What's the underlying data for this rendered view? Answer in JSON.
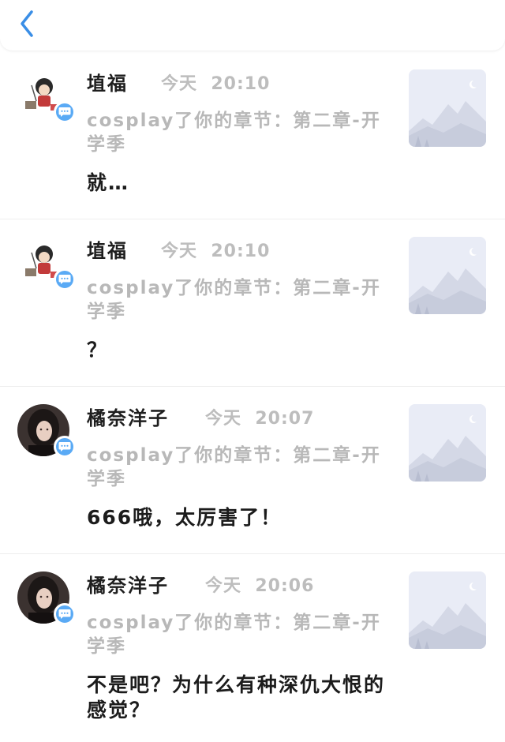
{
  "header": {
    "back_icon": "chevron-left-icon",
    "accent_color": "#3a8ee6"
  },
  "notifications": [
    {
      "user": "埴福",
      "day": "今天",
      "time": "20:10",
      "action": "cosplay了你的章节：第二章-开学季",
      "comment": "就…",
      "avatar": "cartoon-character-avatar",
      "badge_icon": "chat-bubble-icon",
      "thumbnail": "mountain-placeholder-image"
    },
    {
      "user": "埴福",
      "day": "今天",
      "time": "20:10",
      "action": "cosplay了你的章节：第二章-开学季",
      "comment": "？",
      "avatar": "cartoon-character-avatar",
      "badge_icon": "chat-bubble-icon",
      "thumbnail": "mountain-placeholder-image"
    },
    {
      "user": "橘奈洋子",
      "day": "今天",
      "time": "20:07",
      "action": "cosplay了你的章节：第二章-开学季",
      "comment": "666哦，太厉害了！",
      "avatar": "portrait-photo-avatar",
      "badge_icon": "chat-bubble-icon",
      "thumbnail": "mountain-placeholder-image"
    },
    {
      "user": "橘奈洋子",
      "day": "今天",
      "time": "20:06",
      "action": "cosplay了你的章节：第二章-开学季",
      "comment": "不是吧？为什么有种深仇大恨的感觉？",
      "avatar": "portrait-photo-avatar",
      "badge_icon": "chat-bubble-icon",
      "thumbnail": "mountain-placeholder-image"
    }
  ]
}
